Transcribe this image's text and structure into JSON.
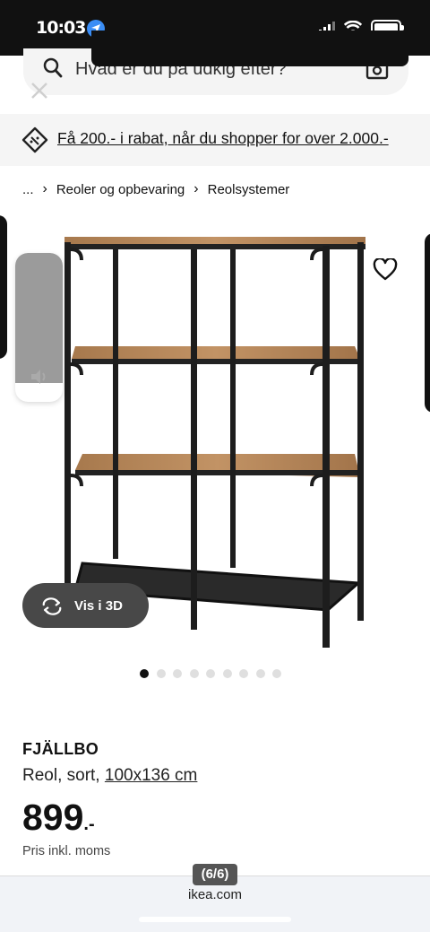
{
  "status_bar": {
    "time": "10:03"
  },
  "search": {
    "placeholder": "Hvad er du på udkig efter?"
  },
  "promo": {
    "text": "Få 200.- i rabat, når du shopper for over 2.000.-"
  },
  "breadcrumb": {
    "ellipsis": "...",
    "items": [
      "Reoler og opbevaring",
      "Reolsystemer"
    ]
  },
  "gallery": {
    "view_3d_label": "Vis i 3D",
    "total_images": 9,
    "active_index": 0
  },
  "product": {
    "name": "FJÄLLBO",
    "description_prefix": "Reol, sort, ",
    "dimensions": "100x136 cm",
    "price": "899",
    "price_suffix": ".-",
    "vat_note": "Pris inkl. moms"
  },
  "browser": {
    "page_counter": "(6/6)",
    "domain": "ikea.com"
  },
  "colors": {
    "status_bar": "#111111",
    "promo_bg": "#f5f5f5",
    "button_3d": "#484848",
    "dot_active": "#111111",
    "dot_inactive": "#dfdfdf"
  },
  "icons": [
    "search-icon",
    "camera-icon",
    "close-icon",
    "tag-icon",
    "heart-icon",
    "rotate-3d-icon",
    "speaker-icon"
  ]
}
